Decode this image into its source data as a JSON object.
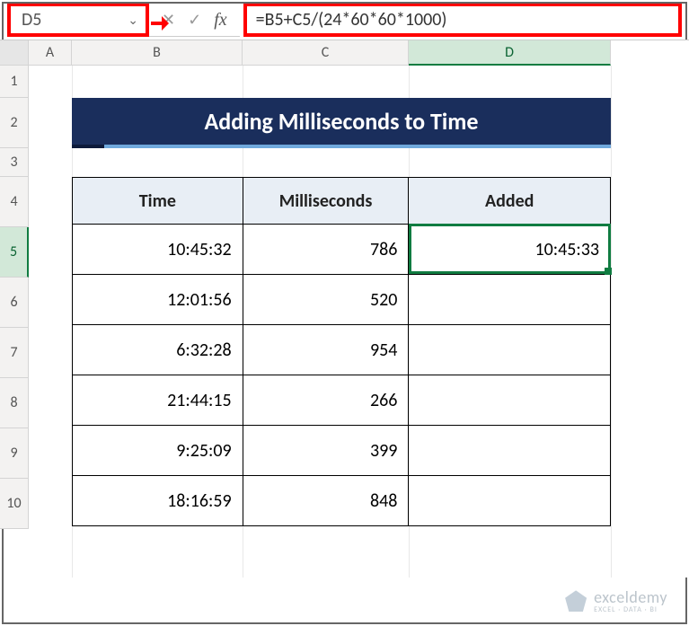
{
  "name_box": "D5",
  "formula": "=B5+C5/(24*60*60*1000)",
  "columns": [
    "",
    "A",
    "B",
    "C",
    "D"
  ],
  "selected_column": "D",
  "row_numbers": [
    1,
    2,
    3,
    4,
    5,
    6,
    7,
    8,
    9,
    10
  ],
  "selected_row": 5,
  "title": "Adding Milliseconds to Time",
  "headers": {
    "time": "Time",
    "ms": "Milliseconds",
    "added": "Added"
  },
  "rows": [
    {
      "time": "10:45:32",
      "ms": "786",
      "added": "10:45:33"
    },
    {
      "time": "12:01:56",
      "ms": "520",
      "added": ""
    },
    {
      "time": "6:32:28",
      "ms": "954",
      "added": ""
    },
    {
      "time": "21:44:15",
      "ms": "266",
      "added": ""
    },
    {
      "time": "9:25:09",
      "ms": "399",
      "added": ""
    },
    {
      "time": "18:16:59",
      "ms": "848",
      "added": ""
    }
  ],
  "fb_icons": {
    "cancel": "✕",
    "enter": "✓",
    "fx": "fx"
  },
  "watermark": {
    "brand": "exceldemy",
    "sub": "EXCEL · DATA · BI"
  }
}
